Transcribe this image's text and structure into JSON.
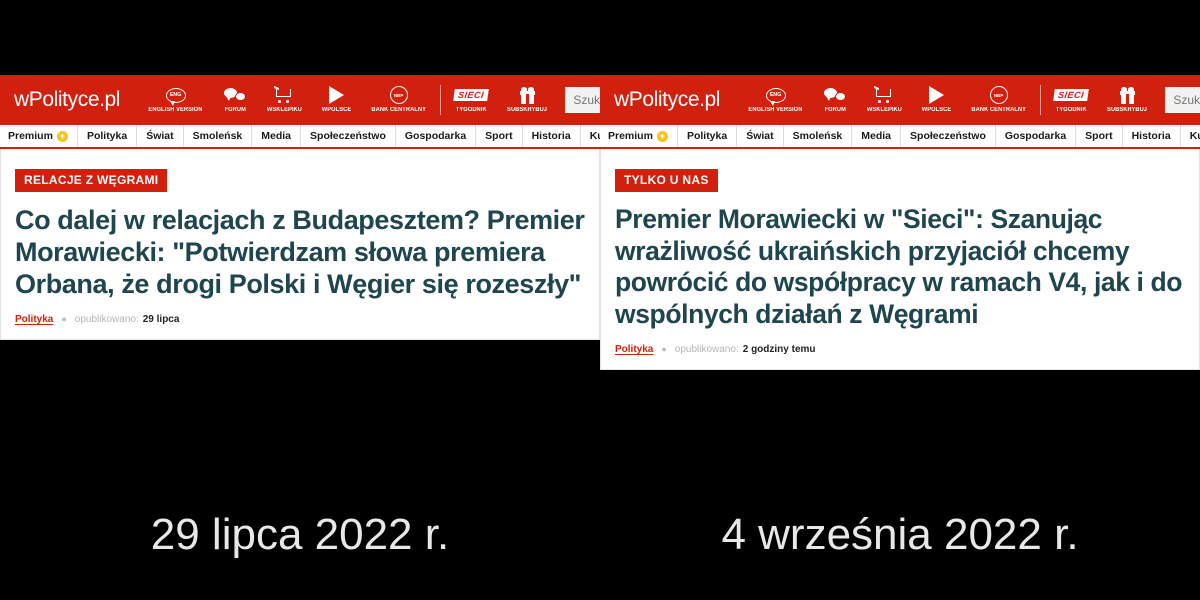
{
  "site": {
    "logo": "wPolityce.pl",
    "header_items": [
      {
        "icon": "eng-globe-icon",
        "label": "ENGLISH VERSION"
      },
      {
        "icon": "chat-bubbles-icon",
        "label": "FORUM"
      },
      {
        "icon": "shopping-cart-icon",
        "label": "WSKLEPIKU"
      },
      {
        "icon": "play-triangle-icon",
        "label": "WPOLSCE"
      },
      {
        "icon": "nbp-circle-icon",
        "label": "BANK CENTRALNY"
      },
      {
        "icon": "sieci-logo-icon",
        "label": "TYGODNIK"
      },
      {
        "icon": "gift-box-icon",
        "label": "SUBSKRYBUJ"
      }
    ],
    "search": {
      "value": "",
      "placeholder": "Szukaj"
    },
    "nav_items": [
      {
        "label": "Premium",
        "badge": "+"
      },
      {
        "label": "Polityka"
      },
      {
        "label": "Świat"
      },
      {
        "label": "Smoleńsk"
      },
      {
        "label": "Media"
      },
      {
        "label": "Społeczeństwo"
      },
      {
        "label": "Gospodarka"
      },
      {
        "label": "Sport"
      },
      {
        "label": "Historia"
      },
      {
        "label": "Kultura"
      }
    ]
  },
  "colors": {
    "brand_red": "#d2200f",
    "headline_teal": "#1f454e",
    "premium_yellow": "#f5c518",
    "backdrop_black": "#000000"
  },
  "panels": {
    "left": {
      "tag": "RELACJE Z WĘGRAMI",
      "headline": "Co dalej w relacjach z Budapesztem? Premier Morawiecki: \"Potwierdzam słowa premiera Orbana, że drogi Polski i Węgier się rozeszły\"",
      "byline": {
        "category": "Polityka",
        "separator": "●",
        "published_label": "opublikowano:",
        "time": "29 lipca"
      },
      "caption": "29 lipca 2022 r."
    },
    "right": {
      "tag": "TYLKO U NAS",
      "headline": "Premier Morawiecki w \"Sieci\": Szanując wrażliwość ukraińskich przyjaciół chcemy powrócić do współpracy w ramach V4, jak i do wspólnych działań z Węgrami",
      "byline": {
        "category": "Polityka",
        "separator": "●",
        "published_label": "opublikowano:",
        "time": "2 godziny temu"
      },
      "caption": "4 września 2022 r."
    }
  }
}
